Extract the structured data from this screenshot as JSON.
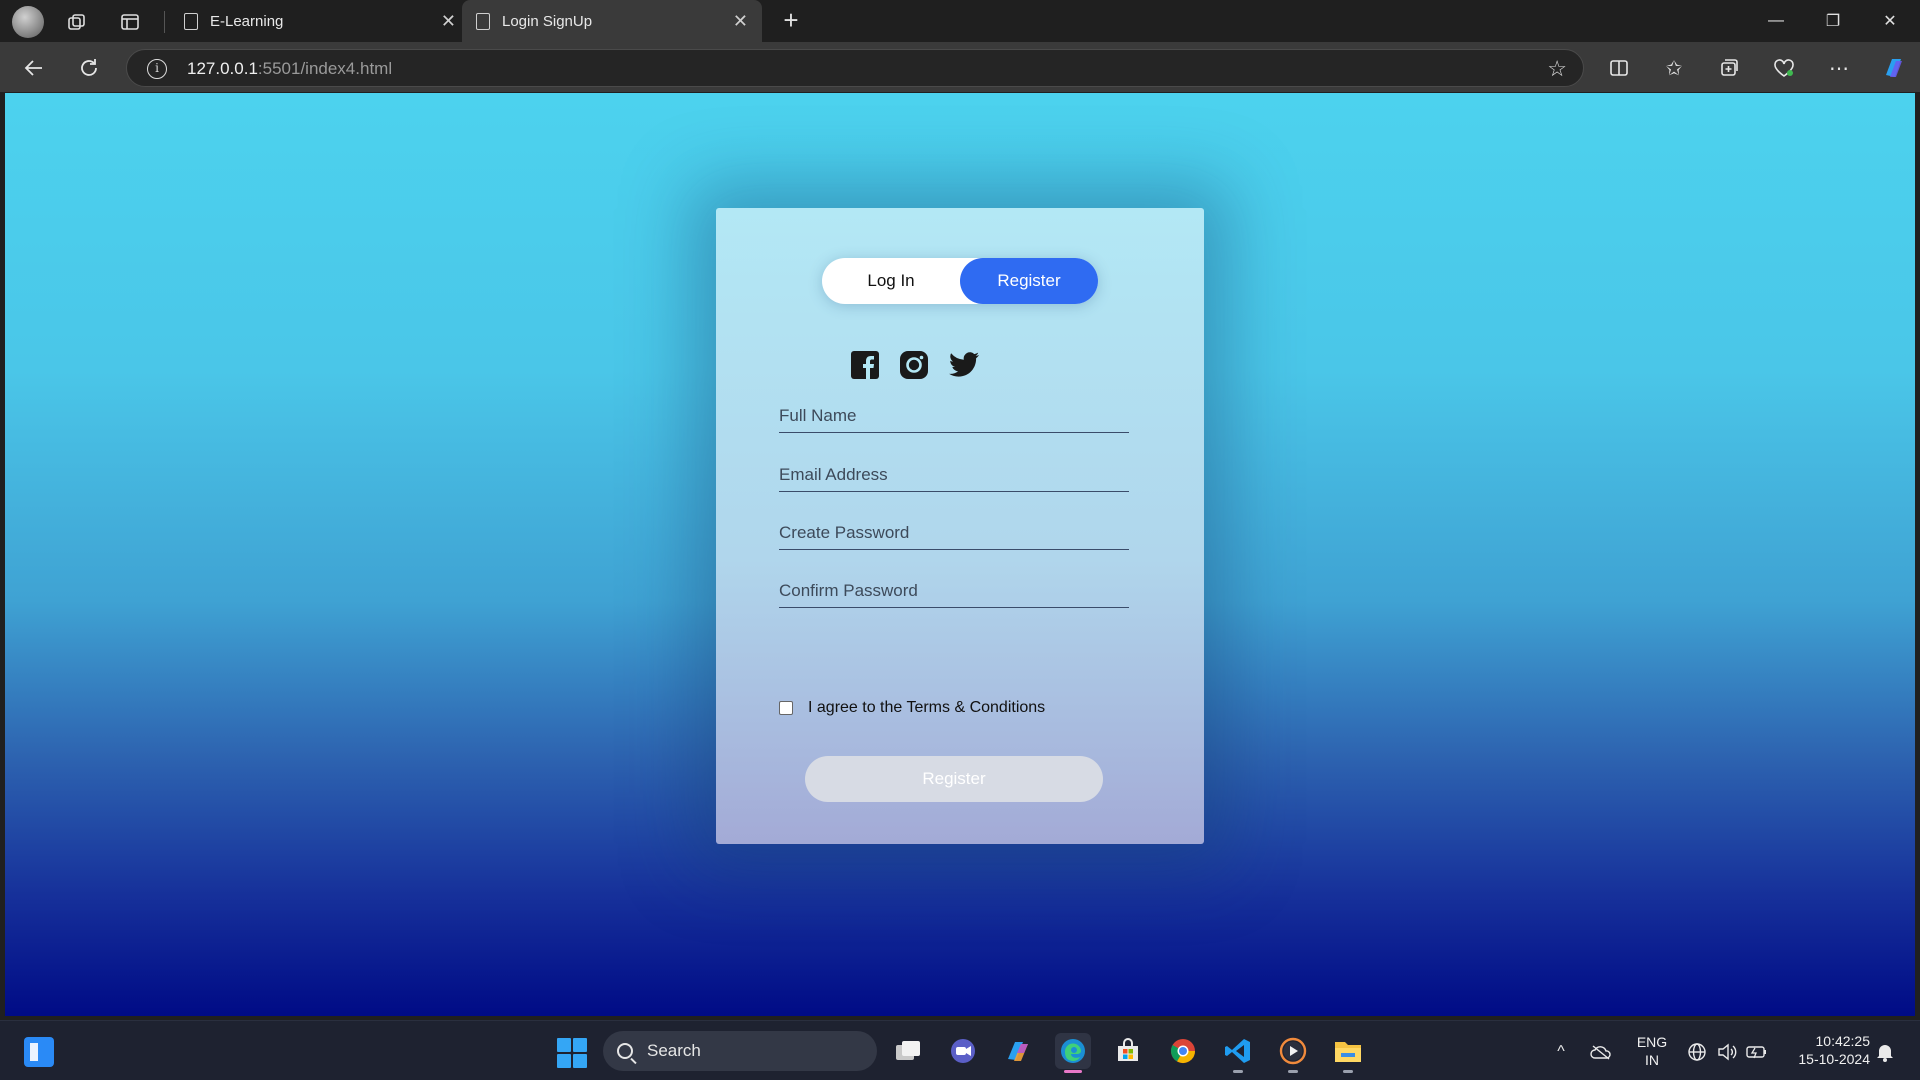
{
  "browser": {
    "tabs": [
      {
        "title": "E-Learning",
        "active": false
      },
      {
        "title": "Login SignUp",
        "active": true
      }
    ],
    "url_host": "127.0.0.1",
    "url_rest": ":5501/index4.html"
  },
  "form": {
    "toggle_login": "Log In",
    "toggle_register": "Register",
    "social_icons": [
      "facebook-icon",
      "instagram-icon",
      "twitter-icon"
    ],
    "fields": {
      "full_name": {
        "placeholder": "Full Name",
        "value": ""
      },
      "email": {
        "placeholder": "Email Address",
        "value": ""
      },
      "create_password": {
        "placeholder": "Create Password",
        "value": ""
      },
      "confirm_password": {
        "placeholder": "Confirm Password",
        "value": ""
      }
    },
    "terms_label": "I agree to the Terms & Conditions",
    "terms_checked": false,
    "submit_label": "Register"
  },
  "taskbar": {
    "search_label": "Search",
    "language_line1": "ENG",
    "language_line2": "IN",
    "time": "10:42:25",
    "date": "15-10-2024"
  },
  "colors": {
    "register_toggle": "#2f6bf2",
    "page_gradient_top": "#4cd2ee",
    "page_gradient_bottom": "#000b86"
  }
}
